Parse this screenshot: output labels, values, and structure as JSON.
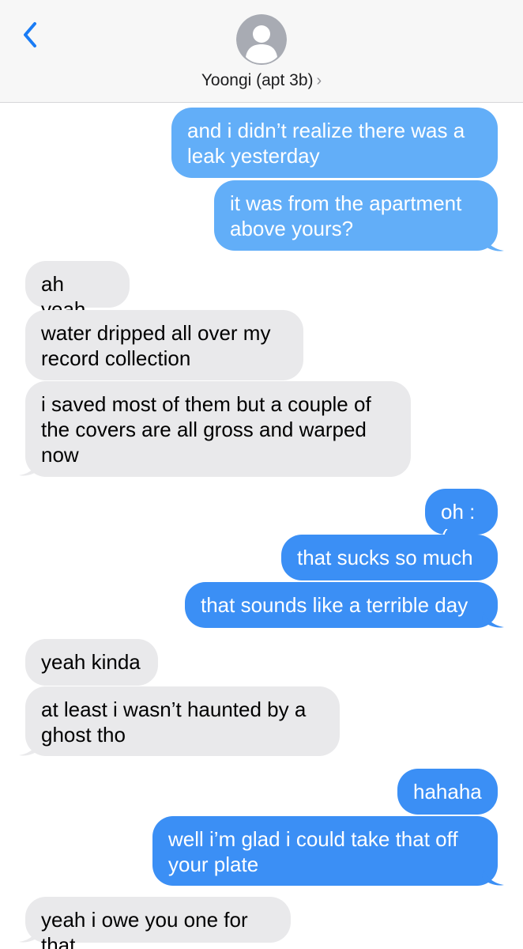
{
  "header": {
    "contact_name": "Yoongi (apt 3b)",
    "chevron": "›",
    "back_icon": "chevron-left-icon",
    "avatar_icon": "person-placeholder-icon"
  },
  "colors": {
    "outgoing": "#3b8ff5",
    "outgoing_faded": "#62aef8",
    "incoming": "#e9e9eb",
    "accent": "#1a7cf5"
  },
  "messages": [
    {
      "sender": "me",
      "text": "and i didn’t realize there was a leak yesterday"
    },
    {
      "sender": "me",
      "text": "it was from the apartment above yours?"
    },
    {
      "sender": "them",
      "text": "ah yeah"
    },
    {
      "sender": "them",
      "text": "water dripped all over my record collection"
    },
    {
      "sender": "them",
      "text": "i saved most of them but a couple of the covers are all gross and warped now"
    },
    {
      "sender": "me",
      "text": "oh :("
    },
    {
      "sender": "me",
      "text": "that sucks so much"
    },
    {
      "sender": "me",
      "text": "that sounds like a terrible day"
    },
    {
      "sender": "them",
      "text": "yeah kinda"
    },
    {
      "sender": "them",
      "text": "at least i wasn’t haunted by a ghost tho"
    },
    {
      "sender": "me",
      "text": "hahaha"
    },
    {
      "sender": "me",
      "text": "well i’m glad i could take that off your plate"
    },
    {
      "sender": "them",
      "text": "yeah i owe you one for that"
    }
  ]
}
